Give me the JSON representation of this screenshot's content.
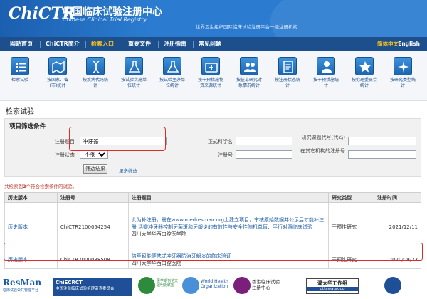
{
  "header": {
    "logo": "ChiCTR",
    "title_cn": "中国临床试验注册中心",
    "title_en": "Chinese Clinical Trial Registry",
    "subtitle": "世界卫生组织国际临床试验注册平台一级注册机构"
  },
  "nav": {
    "items": [
      "网站首页",
      "ChiCTR简介",
      "检索入口",
      "重要文件",
      "注册指南",
      "常见问题"
    ],
    "active": "检索入口",
    "lang_cn": "简体中文",
    "lang_en": "English"
  },
  "toolbar": {
    "items": [
      {
        "label": "检索试验",
        "icon": "list-icon"
      },
      {
        "label": "按国家、省(市)统计",
        "icon": "map-icon"
      },
      {
        "label": "按疾病代码统计",
        "icon": "dna-icon"
      },
      {
        "label": "按试验实施单位统计",
        "icon": "flask-icon"
      },
      {
        "label": "按试验主办单位统计",
        "icon": "flask-icon"
      },
      {
        "label": "按干预措施物资来源统计",
        "icon": "medkit-icon"
      },
      {
        "label": "按征募研究对象情况统计",
        "icon": "people-icon"
      },
      {
        "label": "按注册状态统计",
        "icon": "document-icon"
      },
      {
        "label": "按干预措施统计",
        "icon": "doctor-icon"
      },
      {
        "label": "按伦理委员会统计",
        "icon": "star-icon"
      },
      {
        "label": "按研究类型统计",
        "icon": "sparkle-icon"
      }
    ]
  },
  "search": {
    "section_title": "检索试验",
    "filter_title": "项目筛选条件",
    "labels": {
      "title": "注册题目",
      "scientific_title": "正式科学名",
      "project_code": "研究课题代号(代码)",
      "status": "注册状态",
      "reg_no": "注册号",
      "other_reg_no": "在其它机构的注册号"
    },
    "values": {
      "title": "冲牙器",
      "scientific_title": "",
      "project_code": "",
      "status": "不限",
      "reg_no": "",
      "other_reg_no": ""
    },
    "search_button": "筛选结果",
    "more_link": "更多筛选"
  },
  "results": {
    "note_prefix": "共检索到",
    "count": "2",
    "note_suffix": "个符合检索条件的试验。",
    "columns": [
      "历史版本",
      "注册号",
      "注册题目",
      "研究类型",
      "注册时间"
    ],
    "rows": [
      {
        "history": "历史版本",
        "reg_no": "ChiCTR2100054254",
        "title": "此为补注册，需在www.medresman.org上建立项目，审核原始数据并公示后才能补注册 活瓣冲牙器控制牙菌斑和牙龈炎的有效性与安全性随机单盲、平行对照临床试验",
        "institution": "四川大学华西口腔医学院",
        "type": "干预性研究",
        "date": "2021/12/11"
      },
      {
        "history": "历史版本",
        "reg_no": "ChiCTR2000038508",
        "title": "倍至智能便携式冲牙器防治牙龈炎的临床验证",
        "institution": "四川大学华西口腔医院",
        "type": "干预性研究",
        "date": "2020/09/23"
      }
    ]
  },
  "footer": {
    "resman": "ResMan",
    "resman_sub": "临床试验公共管理平台",
    "chiecrct": "ChiECRCT",
    "chiecrct_sub": "中国注册临床试验伦理审查委员会",
    "medicine_text": "医学期刊论文透明化联盟",
    "who_line1": "World Health",
    "who_line2": "Organization",
    "hk_line1": "香港临床试验",
    "hk_line2": "注册中心",
    "ottawa": "渥太华工作组",
    "ottawa_sub": "ottawagroup"
  },
  "colors": {
    "header_blue": "#2b7cd0",
    "nav_blue": "#1d4f8c",
    "active_yellow": "#f7c21e",
    "highlight_red": "#e02a2a",
    "link_blue": "#1c5ba5"
  }
}
